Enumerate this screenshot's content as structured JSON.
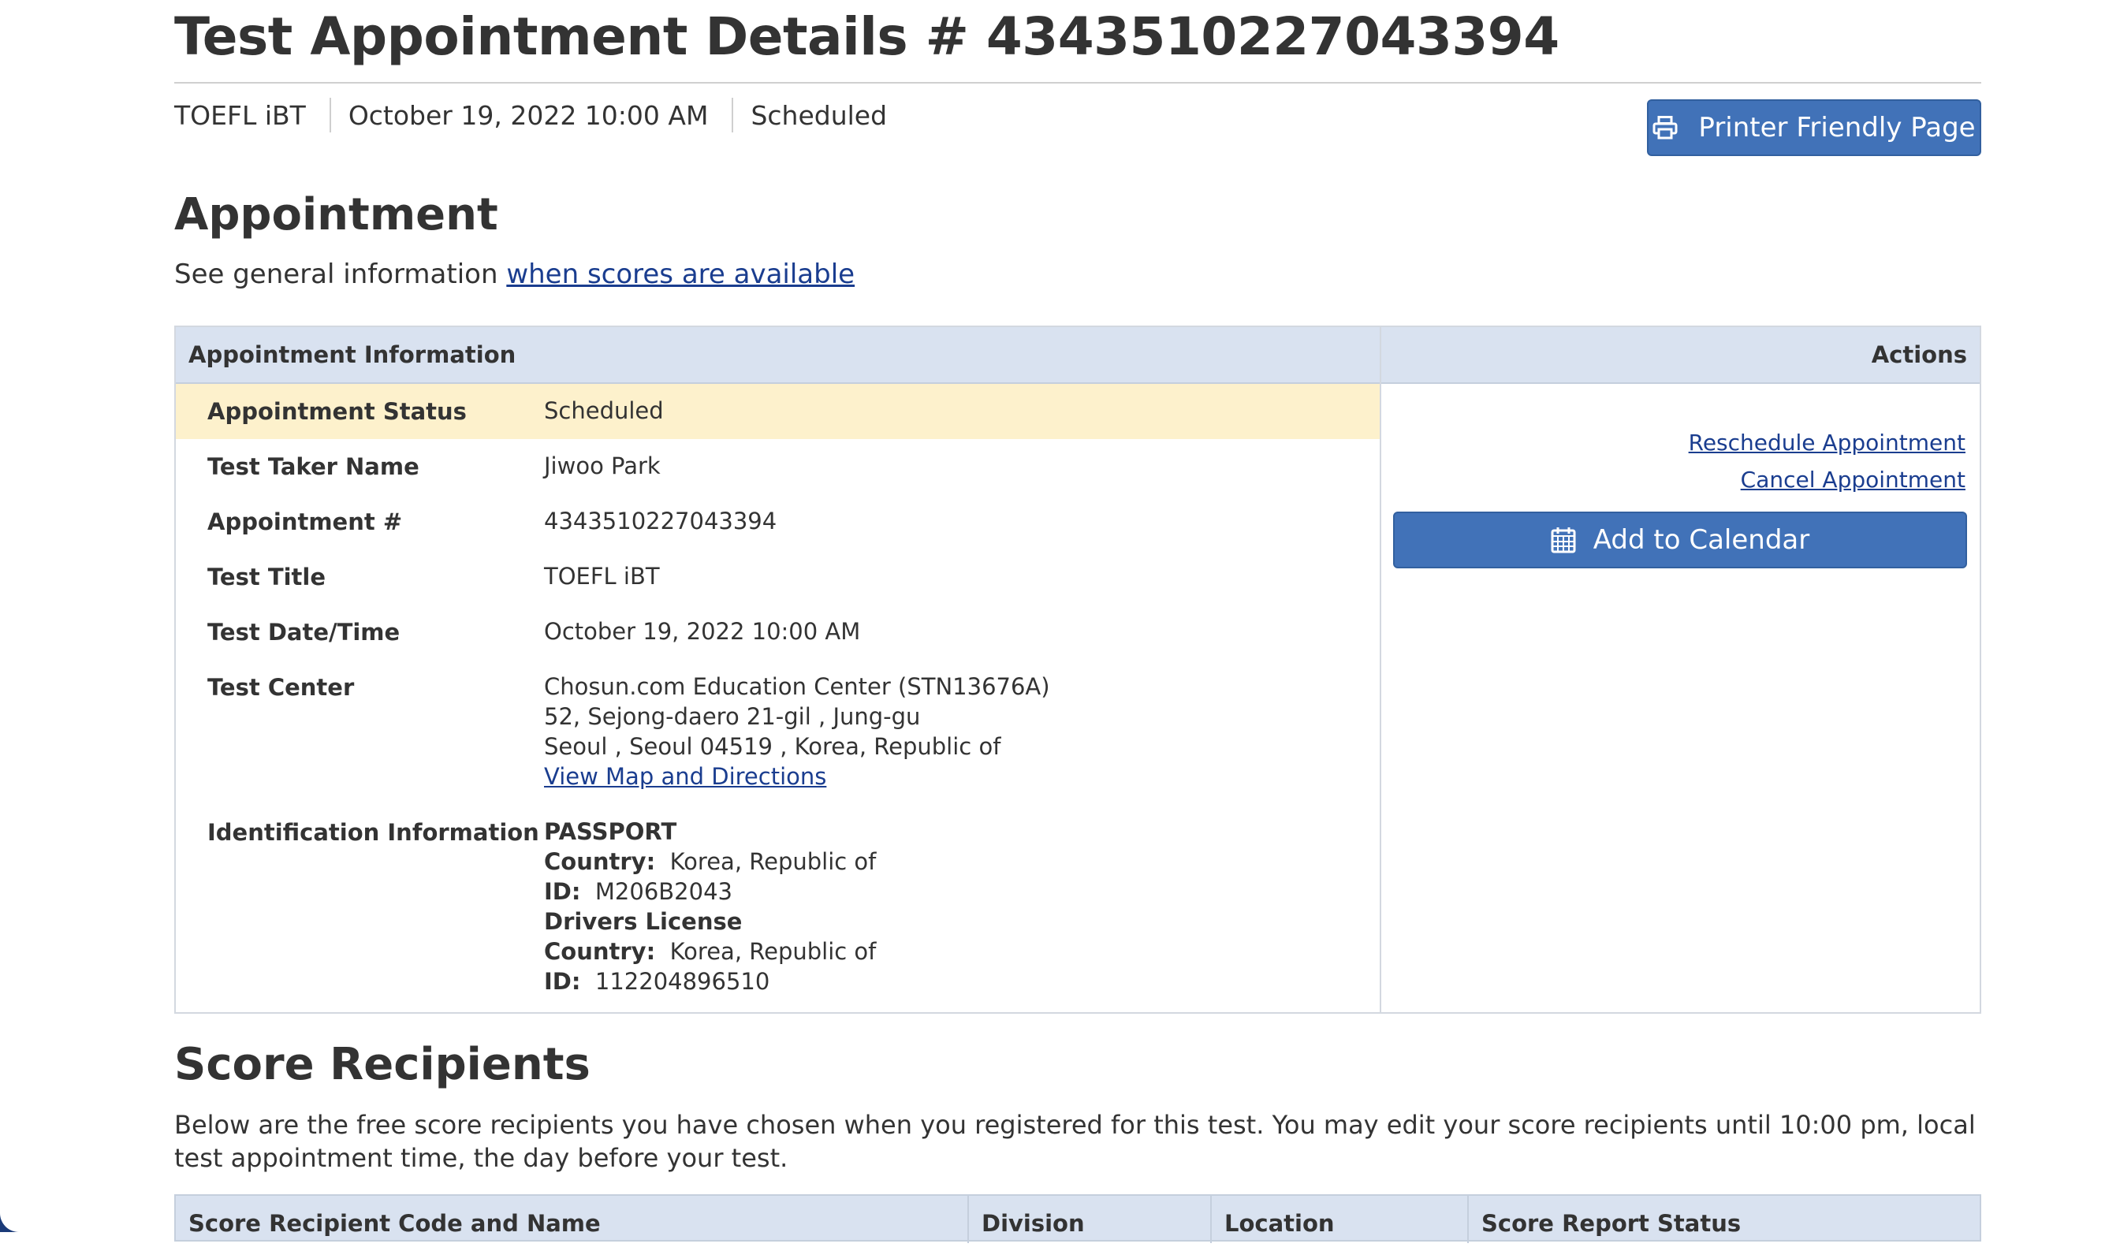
{
  "header": {
    "title": "Test Appointment Details # 4343510227043394",
    "meta": [
      "TOEFL iBT",
      "October 19, 2022 10:00 AM",
      "Scheduled"
    ],
    "print_button": "Printer Friendly Page",
    "print_icon": "printer-icon"
  },
  "appointment": {
    "heading": "Appointment",
    "intro_text": "See general information ",
    "intro_link": "when scores are available",
    "table_header": "Appointment Information",
    "actions_header": "Actions",
    "rows": {
      "status": {
        "label": "Appointment Status",
        "value": "Scheduled"
      },
      "name": {
        "label": "Test Taker Name",
        "value": "Jiwoo Park"
      },
      "number": {
        "label": "Appointment #",
        "value": "4343510227043394"
      },
      "title": {
        "label": "Test Title",
        "value": "TOEFL iBT"
      },
      "datetime": {
        "label": "Test Date/Time",
        "value": "October 19, 2022 10:00 AM"
      },
      "center": {
        "label": "Test Center",
        "lines": [
          "Chosun.com Education Center (STN13676A)",
          "52, Sejong-daero 21-gil , Jung-gu",
          "Seoul , Seoul  04519 , Korea, Republic of"
        ],
        "map_link": "View Map and Directions"
      },
      "identification": {
        "label": "Identification Information",
        "docs": [
          {
            "type": "PASSPORT",
            "country_label": "Country:",
            "country": "Korea, Republic of",
            "id_label": "ID:",
            "id": "M206B2043"
          },
          {
            "type": "Drivers License",
            "country_label": "Country:",
            "country": "Korea, Republic of",
            "id_label": "ID:",
            "id": "112204896510"
          }
        ]
      }
    },
    "actions": {
      "reschedule": "Reschedule Appointment",
      "cancel": "Cancel Appointment",
      "calendar_button": "Add to Calendar",
      "calendar_icon": "calendar-icon"
    }
  },
  "score_recipients": {
    "heading": "Score Recipients",
    "text": "Below are the free score recipients you have chosen when you registered for this test. You may edit your score recipients until 10:00 pm, local test appointment time, the day before your test.",
    "columns": [
      "Score Recipient Code and Name",
      "Division",
      "Location",
      "Score Report Status"
    ]
  },
  "colors": {
    "accent": "#4172b8",
    "header_bg": "#d9e2f0",
    "status_bg": "#fdf1cc",
    "link": "#1a3d8f"
  }
}
